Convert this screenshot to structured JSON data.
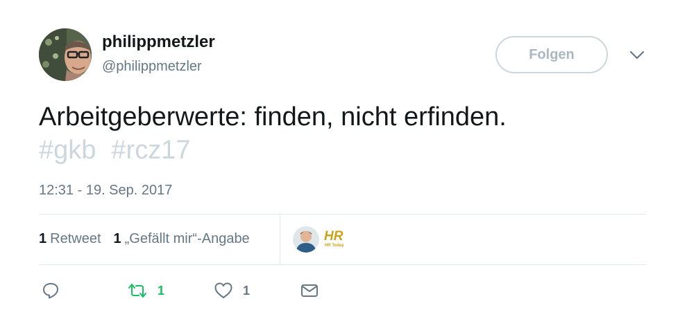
{
  "user": {
    "display_name": "philippmetzler",
    "screen_name": "@philippmetzler",
    "avatar_icon": "profile-photo"
  },
  "header": {
    "follow_label": "Folgen",
    "more_icon": "chevron-down-icon"
  },
  "tweet": {
    "text": "Arbeitgeberwerte: finden, nicht erfinden.",
    "hashtags": [
      "#gkb",
      "#rcz17"
    ],
    "timestamp": "12:31 - 19. Sep. 2017"
  },
  "stats": {
    "retweet_count": "1",
    "retweet_label": "Retweet",
    "like_count": "1",
    "like_label": "„Gefällt mir“-Angabe"
  },
  "likers": [
    {
      "icon": "person-avatar"
    },
    {
      "icon": "hr-today-logo"
    }
  ],
  "actions": {
    "reply_icon": "reply-icon",
    "retweet_icon": "retweet-icon",
    "retweet_count": "1",
    "like_icon": "heart-icon",
    "like_count": "1",
    "dm_icon": "envelope-icon"
  },
  "colors": {
    "text": "#14171a",
    "secondary": "#657786",
    "hashtag": "#ccd6dd",
    "retweet_green": "#17bf63",
    "divider": "#e1e8ed",
    "logo_gold": "#c9a31a"
  }
}
